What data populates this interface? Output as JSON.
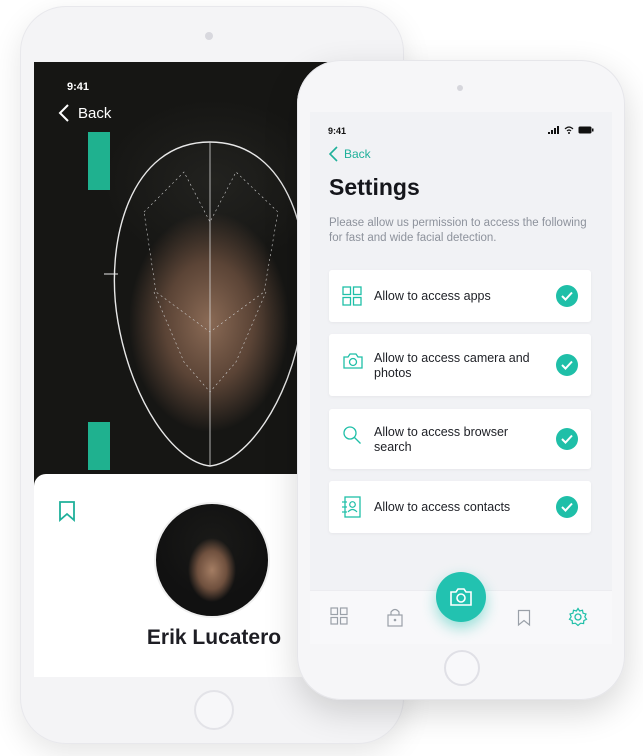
{
  "back_screen": {
    "status_time": "9:41",
    "back_label": "Back",
    "profile_name": "Erik Lucatero"
  },
  "settings_screen": {
    "status_time": "9:41",
    "back_label": "Back",
    "title": "Settings",
    "description": "Please allow us permission to access the following for fast and wide facial detection.",
    "permissions": [
      {
        "label": "Allow to access apps",
        "icon": "grid-icon",
        "checked": true
      },
      {
        "label": "Allow to access camera and photos",
        "icon": "camera-icon",
        "checked": true
      },
      {
        "label": "Allow to access browser search",
        "icon": "search-icon",
        "checked": true
      },
      {
        "label": "Allow to access contacts",
        "icon": "contacts-icon",
        "checked": true
      }
    ],
    "tabbar": [
      "grid-icon",
      "lock-icon",
      "camera-icon",
      "bookmark-icon",
      "gear-icon"
    ]
  },
  "colors": {
    "accent": "#1fbfa8",
    "accent_dark": "#1fb09a",
    "title": "#15161b",
    "muted": "#8d929c"
  }
}
